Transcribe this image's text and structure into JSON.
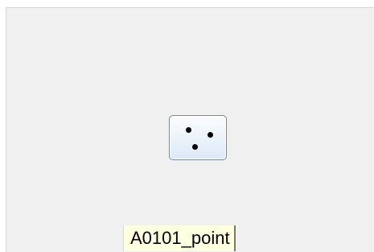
{
  "dice_button": {
    "icon": "dice-three-icon",
    "pips": 3
  },
  "tooltip": {
    "text": "A0101_point"
  },
  "colors": {
    "panel_background": "#f0f0f0",
    "tooltip_background": "#ffffe1",
    "button_border": "#7a8898"
  }
}
